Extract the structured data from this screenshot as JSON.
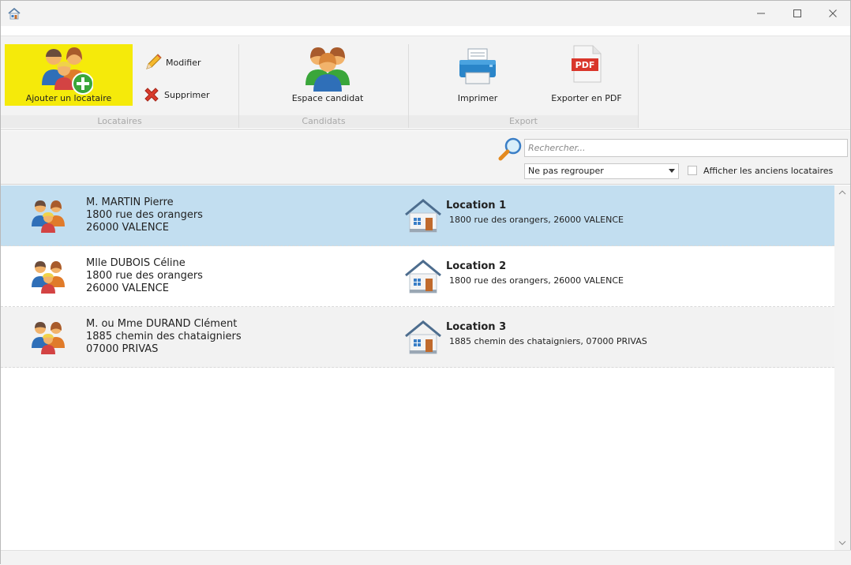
{
  "window": {
    "controls": [
      "minimize-icon",
      "maximize-icon",
      "close-icon"
    ]
  },
  "ribbon": {
    "groups": {
      "locataires": "Locataires",
      "candidats": "Candidats",
      "export": "Export"
    },
    "buttons": {
      "add_tenant": "Ajouter un locataire",
      "modify": "Modifier",
      "delete": "Supprimer",
      "candidate_space": "Espace candidat",
      "print": "Imprimer",
      "export_pdf": "Exporter en PDF"
    }
  },
  "search": {
    "placeholder": "Rechercher..."
  },
  "filter": {
    "group_select": "Ne pas regrouper",
    "show_former": "Afficher les anciens locataires"
  },
  "tenants": [
    {
      "name": "M. MARTIN Pierre",
      "street": "1800 rue des orangers",
      "city": "26000 VALENCE",
      "location": "Location 1",
      "location_address": "1800 rue des orangers, 26000 VALENCE"
    },
    {
      "name": "Mlle DUBOIS Céline",
      "street": "1800 rue des orangers",
      "city": "26000 VALENCE",
      "location": "Location 2",
      "location_address": "1800 rue des orangers, 26000 VALENCE"
    },
    {
      "name": "M. ou Mme DURAND Clément",
      "street": "1885 chemin des chataigniers",
      "city": "07000 PRIVAS",
      "location": "Location 3",
      "location_address": "1885 chemin des chataigniers, 07000 PRIVAS"
    }
  ],
  "colors": {
    "selected_row": "#c2def0",
    "highlight": "#f5ea0a",
    "ribbon_bg": "#f3f3f3"
  }
}
